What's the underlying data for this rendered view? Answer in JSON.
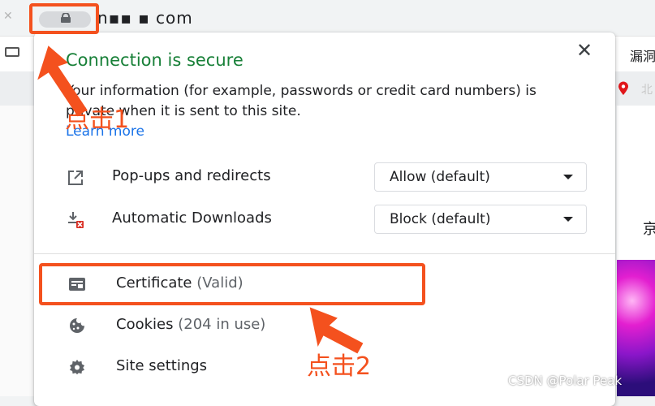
{
  "browser": {
    "url_text": "n▪▪  ▪  com",
    "right_tab_text": "漏洞",
    "right_location_text": "北",
    "right_side_text": "京"
  },
  "popup": {
    "title": "Connection is secure",
    "info_text": "Your information (for example, passwords or credit card numbers) is private when it is sent to this site.",
    "learn_more": "Learn more",
    "close_label": "✕",
    "permissions": [
      {
        "label": "Pop-ups and redirects",
        "value": "Allow (default)",
        "icon": "external-link-icon"
      },
      {
        "label": "Automatic Downloads",
        "value": "Block (default)",
        "icon": "download-blocked-icon"
      }
    ],
    "menu": [
      {
        "label": "Certificate",
        "sub": "(Valid)",
        "icon": "certificate-icon"
      },
      {
        "label": "Cookies",
        "sub": "(204 in use)",
        "icon": "cookie-icon"
      },
      {
        "label": "Site settings",
        "sub": "",
        "icon": "gear-icon"
      }
    ]
  },
  "annotations": {
    "click1": "点击1",
    "click2": "点击2",
    "color": "#f4511e"
  },
  "watermark": "CSDN @Polar Peak",
  "colors": {
    "secure_green": "#188038",
    "link_blue": "#1a73e8"
  }
}
